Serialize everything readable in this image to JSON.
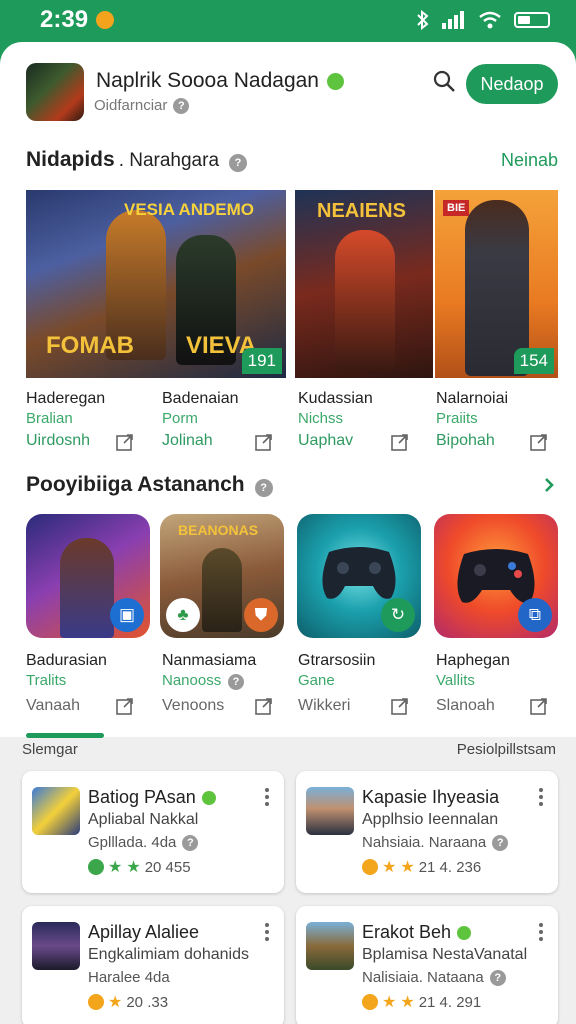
{
  "status_bar": {
    "time": "2:39"
  },
  "header": {
    "app_title": "Naplrik Soooa Nadagan",
    "app_subtitle": "Oidfarnciar",
    "primary_button": "Nedaop"
  },
  "featured": {
    "title": "Nidapids",
    "subtitle": ". Narahgara",
    "link": "Neinab",
    "banner_left": {
      "top_text": "VESIA ANDEMO",
      "left_text": "FOMAB",
      "right_text": "VIEVA",
      "rank": "191"
    },
    "banner_mid": {
      "top_text": "NEAIENS"
    },
    "banner_right": {
      "top_text": "BIE",
      "rank": "154"
    },
    "items": [
      {
        "name": "Haderegan",
        "category": "Bralian",
        "meta": "Uirdosnh"
      },
      {
        "name": "Badenaian",
        "category": "Porm",
        "meta": "Jolinah"
      },
      {
        "name": "Kudassian",
        "category": "Nichss",
        "meta": "Uaphav"
      },
      {
        "name": "Nalarnoiai",
        "category": "Praiits",
        "meta": "Bipohah"
      }
    ]
  },
  "popular": {
    "title": "Pooyibiiga Astananch",
    "tiles": [
      {
        "name": "Badurasian",
        "category": "Tralits",
        "meta": "Vanaah",
        "banner": ""
      },
      {
        "name": "Nanmasiama",
        "category": "Nanooss",
        "meta": "Venoons",
        "banner": "BEANONAS"
      },
      {
        "name": "Gtrarsosiin",
        "category": "Gane",
        "meta": "Wikkeri",
        "banner": ""
      },
      {
        "name": "Haphegan",
        "category": "Vallits",
        "meta": "Slanoah",
        "banner": ""
      }
    ]
  },
  "lower": {
    "label_left": "Slemgar",
    "label_right": "Pesiolpillstsam",
    "cards": [
      {
        "title": "Batiog PAsan",
        "line2": "Apliabal Nakkal",
        "line3": "Gplllada. 4da",
        "rating": "20 455"
      },
      {
        "title": "Kapasie Ihyeasia",
        "line2": "Applhsio Ieennalan",
        "line3": "Nahsiaia. Naraana",
        "rating": "21 4. 236"
      },
      {
        "title": "Apillay Alaliee",
        "line2": "Engkalimiam dohanids",
        "line3": "Haralee  4da",
        "rating": "20 .33"
      },
      {
        "title": "Erakot Beh",
        "line2": "Bplamisa NestaVanatal",
        "line3": "Nalisiaia. Nataana",
        "rating": "21 4. 291"
      }
    ]
  },
  "colors": {
    "accent": "#1e9a5a",
    "star": "#f3a51b"
  }
}
